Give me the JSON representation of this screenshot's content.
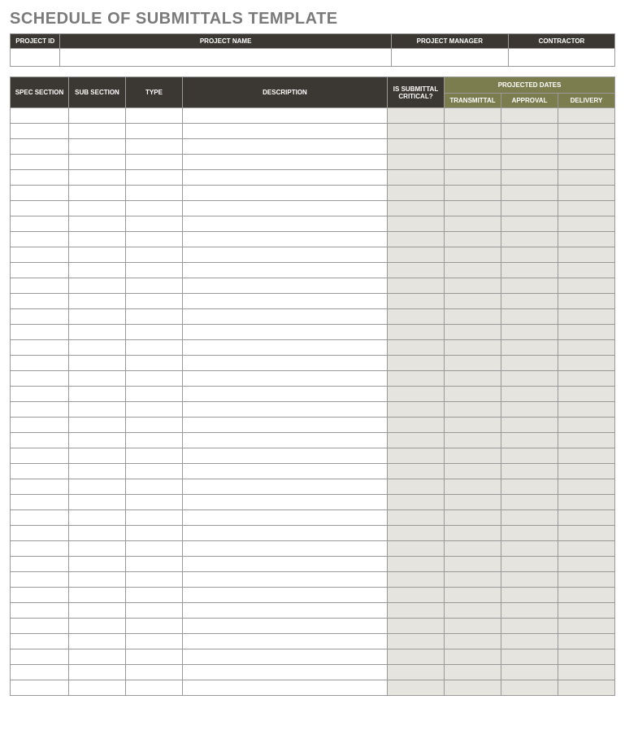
{
  "title": "SCHEDULE OF SUBMITTALS TEMPLATE",
  "proj_headers": {
    "id": "PROJECT ID",
    "name": "PROJECT NAME",
    "pm": "PROJECT MANAGER",
    "contractor": "CONTRACTOR"
  },
  "proj_values": {
    "id": "",
    "name": "",
    "pm": "",
    "contractor": ""
  },
  "main_headers": {
    "spec": "SPEC SECTION",
    "sub": "SUB SECTION",
    "type": "TYPE",
    "desc": "DESCRIPTION",
    "critical": "IS SUBMITTAL CRITICAL?",
    "projected": "PROJECTED DATES",
    "transmittal": "TRANSMITTAL",
    "approval": "APPROVAL",
    "delivery": "DELIVERY"
  },
  "row_count": 38,
  "rows": [
    {
      "spec": "",
      "sub": "",
      "type": "",
      "desc": "",
      "critical": "",
      "transmittal": "",
      "approval": "",
      "delivery": ""
    },
    {
      "spec": "",
      "sub": "",
      "type": "",
      "desc": "",
      "critical": "",
      "transmittal": "",
      "approval": "",
      "delivery": ""
    },
    {
      "spec": "",
      "sub": "",
      "type": "",
      "desc": "",
      "critical": "",
      "transmittal": "",
      "approval": "",
      "delivery": ""
    },
    {
      "spec": "",
      "sub": "",
      "type": "",
      "desc": "",
      "critical": "",
      "transmittal": "",
      "approval": "",
      "delivery": ""
    },
    {
      "spec": "",
      "sub": "",
      "type": "",
      "desc": "",
      "critical": "",
      "transmittal": "",
      "approval": "",
      "delivery": ""
    },
    {
      "spec": "",
      "sub": "",
      "type": "",
      "desc": "",
      "critical": "",
      "transmittal": "",
      "approval": "",
      "delivery": ""
    },
    {
      "spec": "",
      "sub": "",
      "type": "",
      "desc": "",
      "critical": "",
      "transmittal": "",
      "approval": "",
      "delivery": ""
    },
    {
      "spec": "",
      "sub": "",
      "type": "",
      "desc": "",
      "critical": "",
      "transmittal": "",
      "approval": "",
      "delivery": ""
    },
    {
      "spec": "",
      "sub": "",
      "type": "",
      "desc": "",
      "critical": "",
      "transmittal": "",
      "approval": "",
      "delivery": ""
    },
    {
      "spec": "",
      "sub": "",
      "type": "",
      "desc": "",
      "critical": "",
      "transmittal": "",
      "approval": "",
      "delivery": ""
    },
    {
      "spec": "",
      "sub": "",
      "type": "",
      "desc": "",
      "critical": "",
      "transmittal": "",
      "approval": "",
      "delivery": ""
    },
    {
      "spec": "",
      "sub": "",
      "type": "",
      "desc": "",
      "critical": "",
      "transmittal": "",
      "approval": "",
      "delivery": ""
    },
    {
      "spec": "",
      "sub": "",
      "type": "",
      "desc": "",
      "critical": "",
      "transmittal": "",
      "approval": "",
      "delivery": ""
    },
    {
      "spec": "",
      "sub": "",
      "type": "",
      "desc": "",
      "critical": "",
      "transmittal": "",
      "approval": "",
      "delivery": ""
    },
    {
      "spec": "",
      "sub": "",
      "type": "",
      "desc": "",
      "critical": "",
      "transmittal": "",
      "approval": "",
      "delivery": ""
    },
    {
      "spec": "",
      "sub": "",
      "type": "",
      "desc": "",
      "critical": "",
      "transmittal": "",
      "approval": "",
      "delivery": ""
    },
    {
      "spec": "",
      "sub": "",
      "type": "",
      "desc": "",
      "critical": "",
      "transmittal": "",
      "approval": "",
      "delivery": ""
    },
    {
      "spec": "",
      "sub": "",
      "type": "",
      "desc": "",
      "critical": "",
      "transmittal": "",
      "approval": "",
      "delivery": ""
    },
    {
      "spec": "",
      "sub": "",
      "type": "",
      "desc": "",
      "critical": "",
      "transmittal": "",
      "approval": "",
      "delivery": ""
    },
    {
      "spec": "",
      "sub": "",
      "type": "",
      "desc": "",
      "critical": "",
      "transmittal": "",
      "approval": "",
      "delivery": ""
    },
    {
      "spec": "",
      "sub": "",
      "type": "",
      "desc": "",
      "critical": "",
      "transmittal": "",
      "approval": "",
      "delivery": ""
    },
    {
      "spec": "",
      "sub": "",
      "type": "",
      "desc": "",
      "critical": "",
      "transmittal": "",
      "approval": "",
      "delivery": ""
    },
    {
      "spec": "",
      "sub": "",
      "type": "",
      "desc": "",
      "critical": "",
      "transmittal": "",
      "approval": "",
      "delivery": ""
    },
    {
      "spec": "",
      "sub": "",
      "type": "",
      "desc": "",
      "critical": "",
      "transmittal": "",
      "approval": "",
      "delivery": ""
    },
    {
      "spec": "",
      "sub": "",
      "type": "",
      "desc": "",
      "critical": "",
      "transmittal": "",
      "approval": "",
      "delivery": ""
    },
    {
      "spec": "",
      "sub": "",
      "type": "",
      "desc": "",
      "critical": "",
      "transmittal": "",
      "approval": "",
      "delivery": ""
    },
    {
      "spec": "",
      "sub": "",
      "type": "",
      "desc": "",
      "critical": "",
      "transmittal": "",
      "approval": "",
      "delivery": ""
    },
    {
      "spec": "",
      "sub": "",
      "type": "",
      "desc": "",
      "critical": "",
      "transmittal": "",
      "approval": "",
      "delivery": ""
    },
    {
      "spec": "",
      "sub": "",
      "type": "",
      "desc": "",
      "critical": "",
      "transmittal": "",
      "approval": "",
      "delivery": ""
    },
    {
      "spec": "",
      "sub": "",
      "type": "",
      "desc": "",
      "critical": "",
      "transmittal": "",
      "approval": "",
      "delivery": ""
    },
    {
      "spec": "",
      "sub": "",
      "type": "",
      "desc": "",
      "critical": "",
      "transmittal": "",
      "approval": "",
      "delivery": ""
    },
    {
      "spec": "",
      "sub": "",
      "type": "",
      "desc": "",
      "critical": "",
      "transmittal": "",
      "approval": "",
      "delivery": ""
    },
    {
      "spec": "",
      "sub": "",
      "type": "",
      "desc": "",
      "critical": "",
      "transmittal": "",
      "approval": "",
      "delivery": ""
    },
    {
      "spec": "",
      "sub": "",
      "type": "",
      "desc": "",
      "critical": "",
      "transmittal": "",
      "approval": "",
      "delivery": ""
    },
    {
      "spec": "",
      "sub": "",
      "type": "",
      "desc": "",
      "critical": "",
      "transmittal": "",
      "approval": "",
      "delivery": ""
    },
    {
      "spec": "",
      "sub": "",
      "type": "",
      "desc": "",
      "critical": "",
      "transmittal": "",
      "approval": "",
      "delivery": ""
    },
    {
      "spec": "",
      "sub": "",
      "type": "",
      "desc": "",
      "critical": "",
      "transmittal": "",
      "approval": "",
      "delivery": ""
    },
    {
      "spec": "",
      "sub": "",
      "type": "",
      "desc": "",
      "critical": "",
      "transmittal": "",
      "approval": "",
      "delivery": ""
    }
  ]
}
